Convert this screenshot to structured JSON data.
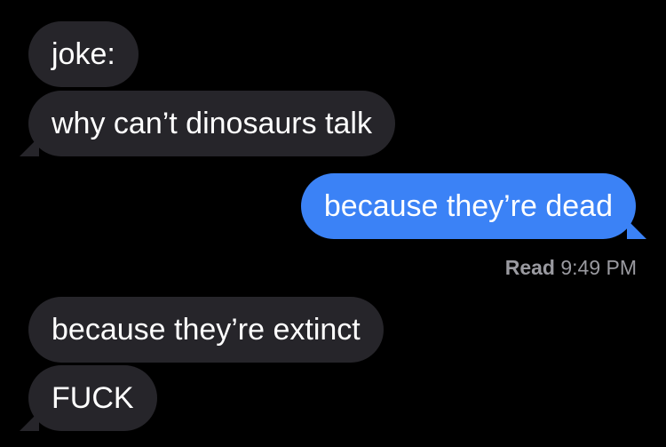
{
  "thread": {
    "messages": [
      {
        "from": "them",
        "text": "joke:"
      },
      {
        "from": "them",
        "text": "why can’t dinosaurs talk"
      },
      {
        "from": "me",
        "text": "because they’re dead"
      },
      {
        "from": "them",
        "text": "because they’re extinct"
      },
      {
        "from": "them",
        "text": "FUCK"
      }
    ],
    "read_receipt": {
      "label": "Read",
      "time": "9:49 PM"
    }
  },
  "colors": {
    "background": "#000000",
    "received_bubble": "#26252a",
    "sent_bubble": "#3b82f6",
    "receipt_text": "#9a9aa0"
  }
}
